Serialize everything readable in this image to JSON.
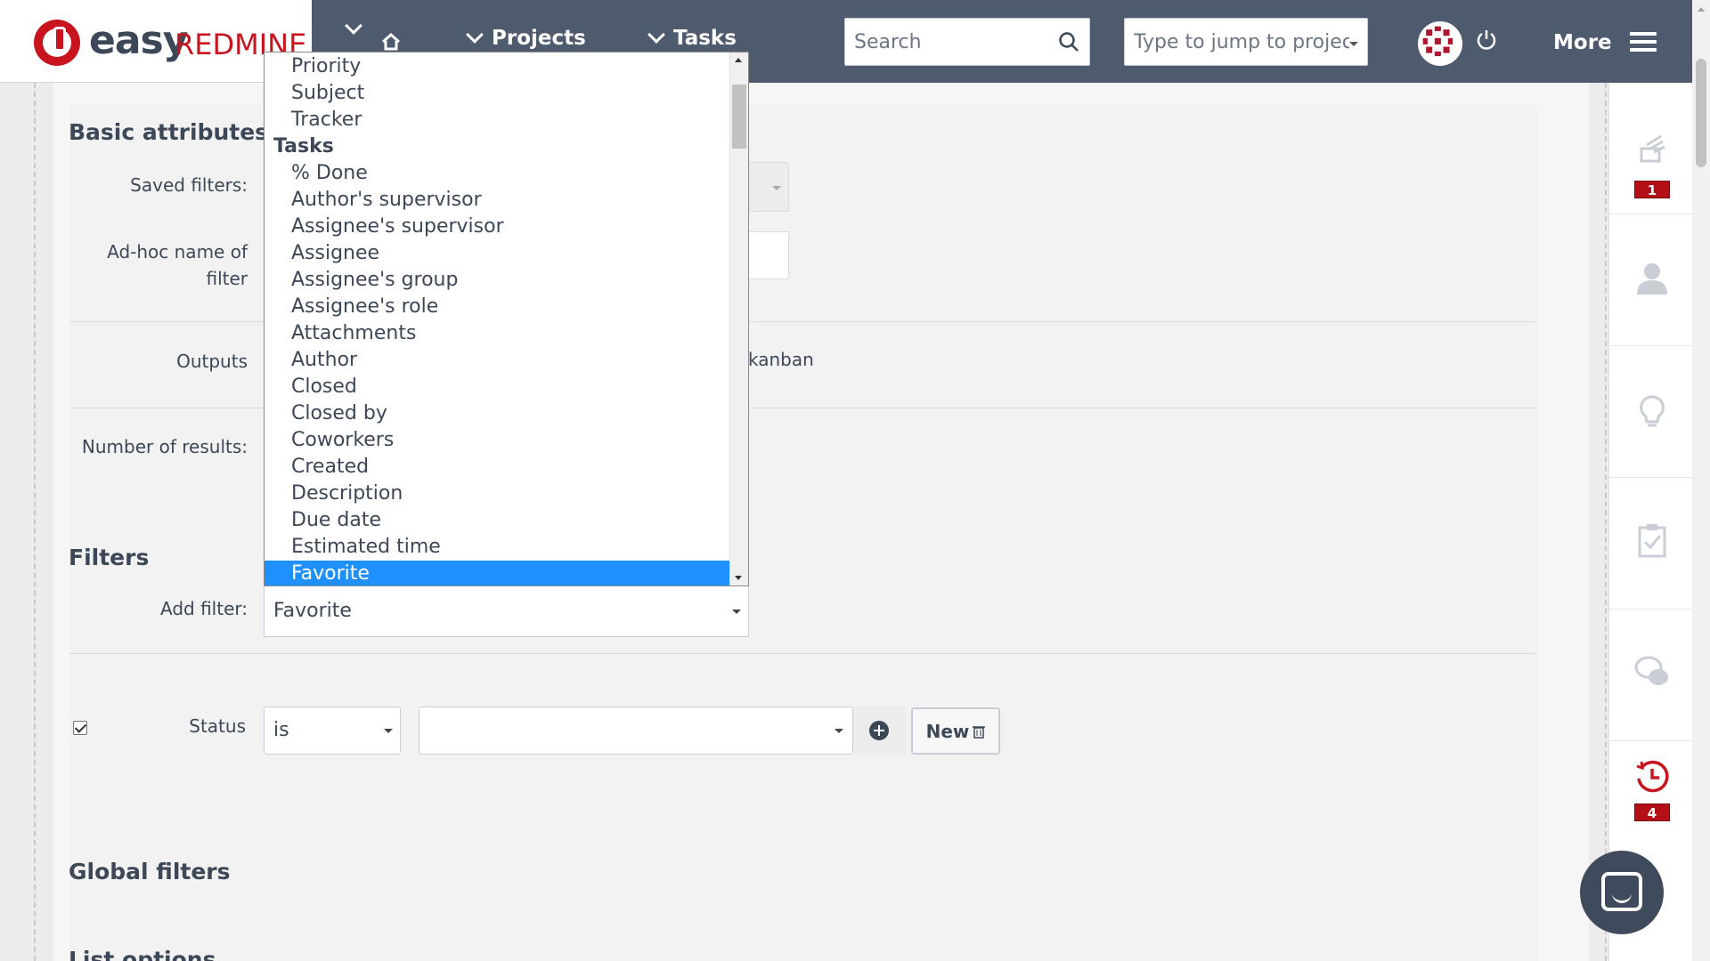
{
  "header": {
    "logo": {
      "part1": "easy",
      "part2": "REDMINE"
    },
    "nav": [
      {
        "label": "",
        "icon": "home-icon"
      },
      {
        "label": "Projects"
      },
      {
        "label": "Tasks"
      }
    ],
    "search_placeholder": "Search",
    "jump_placeholder": "Type to jump to project",
    "more_label": "More"
  },
  "form": {
    "basic_attributes_heading": "Basic attributes:",
    "saved_filters_label": "Saved filters:",
    "adhoc_name_label_line1": "Ad-hoc name of",
    "adhoc_name_label_line2": "filter",
    "outputs_label": "Outputs",
    "outputs_partial": "kanban",
    "number_of_results_label": "Number of results:",
    "filters_heading": "Filters",
    "add_filter_label": "Add filter:",
    "add_filter_value": "Favorite",
    "status_label": "Status",
    "status_operator": "is",
    "new_button_label": "New",
    "global_filters_heading": "Global filters",
    "list_options_heading": "List options"
  },
  "dropdown": {
    "options": [
      {
        "label": "Priority",
        "group": false
      },
      {
        "label": "Subject",
        "group": false
      },
      {
        "label": "Tracker",
        "group": false
      },
      {
        "label": "Tasks",
        "group": true
      },
      {
        "label": "% Done",
        "group": false
      },
      {
        "label": "Author's supervisor",
        "group": false
      },
      {
        "label": "Assignee's supervisor",
        "group": false
      },
      {
        "label": "Assignee",
        "group": false
      },
      {
        "label": "Assignee's group",
        "group": false
      },
      {
        "label": "Assignee's role",
        "group": false
      },
      {
        "label": "Attachments",
        "group": false
      },
      {
        "label": "Author",
        "group": false
      },
      {
        "label": "Closed",
        "group": false
      },
      {
        "label": "Closed by",
        "group": false
      },
      {
        "label": "Coworkers",
        "group": false
      },
      {
        "label": "Created",
        "group": false
      },
      {
        "label": "Description",
        "group": false
      },
      {
        "label": "Due date",
        "group": false
      },
      {
        "label": "Estimated time",
        "group": false
      },
      {
        "label": "Favorite",
        "group": false,
        "selected": true
      }
    ]
  },
  "sidebar": {
    "items": [
      {
        "icon": "activity-feed-icon",
        "badge": "1"
      },
      {
        "icon": "user-icon",
        "badge": ""
      },
      {
        "icon": "lightbulb-icon",
        "badge": ""
      },
      {
        "icon": "clipboard-check-icon",
        "badge": ""
      },
      {
        "icon": "chat-bubbles-icon",
        "badge": ""
      },
      {
        "icon": "history-clock-icon",
        "badge": "4"
      }
    ]
  },
  "colors": {
    "topbar": "#4e5a6e",
    "accent_red": "#c8141e",
    "selection_blue": "#1e90ff",
    "text": "#3c4757"
  }
}
